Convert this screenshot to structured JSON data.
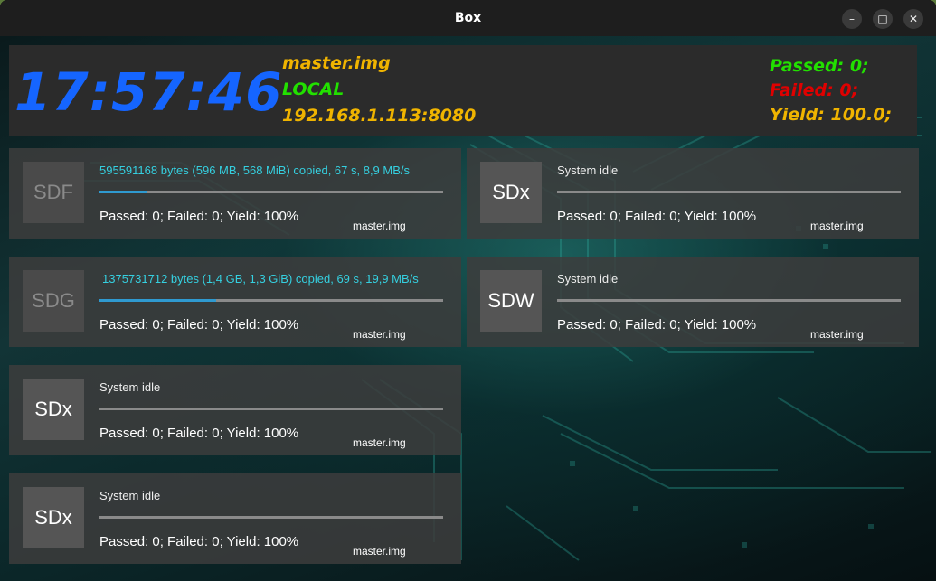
{
  "window": {
    "title": "Box",
    "minimize_glyph": "–",
    "maximize_glyph": "□",
    "close_glyph": "✕"
  },
  "header": {
    "clock": "17:57:46",
    "image_name": "master.img",
    "mode": "LOCAL",
    "address": "192.168.1.113:8080",
    "passed": "Passed: 0;",
    "failed": "Failed: 0;",
    "yield": "Yield: 100.0;",
    "colors": {
      "clock": "#1565ff",
      "image_name": "#f0b400",
      "mode": "#22e000",
      "address": "#f0b400",
      "passed": "#22e000",
      "failed": "#e00000",
      "yield": "#f0b400"
    }
  },
  "devices": [
    {
      "name": "SDF",
      "status": "595591168 bytes (596 MB, 568 MiB) copied, 67 s, 8,9 MB/s",
      "active": true,
      "progress": 0.14,
      "stats": "Passed: 0; Failed: 0; Yield: 100%",
      "image": "master.img"
    },
    {
      "name": "SDx",
      "status": "System idle",
      "active": false,
      "progress": 0,
      "stats": "Passed: 0; Failed: 0; Yield: 100%",
      "image": "master.img"
    },
    {
      "name": "SDG",
      "status": "1375731712 bytes (1,4 GB, 1,3 GiB) copied, 69 s, 19,9 MB/s",
      "active": true,
      "progress": 0.34,
      "stats": "Passed: 0; Failed: 0; Yield: 100%",
      "image": "master.img"
    },
    {
      "name": "SDW",
      "status": "System idle",
      "active": false,
      "progress": 0,
      "stats": "Passed: 0; Failed: 0; Yield: 100%",
      "image": "master.img"
    },
    {
      "name": "SDx",
      "status": "System idle",
      "active": false,
      "progress": 0,
      "stats": "Passed: 0; Failed: 0; Yield: 100%",
      "image": "master.img"
    },
    {
      "name": "SDx",
      "status": "System idle",
      "active": false,
      "progress": 0,
      "stats": "Passed: 0; Failed: 0; Yield: 100%",
      "image": "master.img"
    }
  ]
}
